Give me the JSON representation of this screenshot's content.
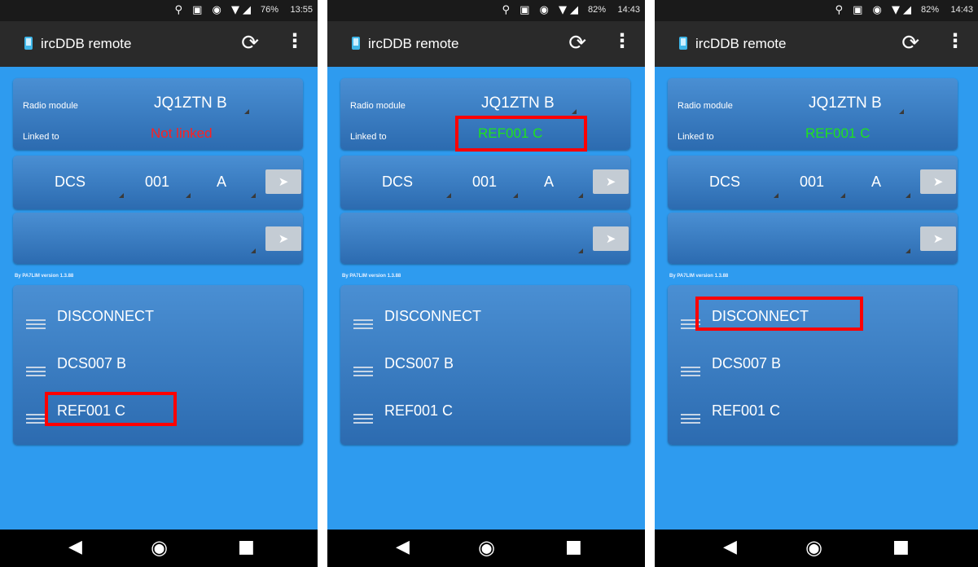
{
  "colors": {
    "background_blue": "#2e9bef",
    "card_blue": "#3a7cc2",
    "not_linked_red": "#ff2020",
    "linked_green": "#1ee21e",
    "highlight_red": "#ff0000"
  },
  "icons": {
    "app": "phone-icon",
    "refresh": "refresh-icon",
    "menu": "overflow-menu-icon",
    "send": "send-arrow-icon",
    "back": "back-icon",
    "home": "home-icon",
    "recent": "recent-apps-icon"
  },
  "app": {
    "title": "ircDDB remote"
  },
  "labels": {
    "radio_module": "Radio module",
    "linked_to": "Linked to",
    "version": "By PA7LIM version 1.3.88"
  },
  "screens": [
    {
      "status": {
        "battery": "76%",
        "time": "13:55"
      },
      "radio_module": "JQ1ZTN B",
      "linked_to": "Not linked",
      "linked_state": "not-linked",
      "spinners": [
        "DCS",
        "001",
        "A"
      ],
      "list": [
        "DISCONNECT",
        "DCS007 B",
        "REF001 C"
      ],
      "highlight": "list item REF001 C"
    },
    {
      "status": {
        "battery": "82%",
        "time": "14:43"
      },
      "radio_module": "JQ1ZTN B",
      "linked_to": "REF001 C",
      "linked_state": "linked",
      "spinners": [
        "DCS",
        "001",
        "A"
      ],
      "list": [
        "DISCONNECT",
        "DCS007 B",
        "REF001 C"
      ],
      "highlight": "linked value"
    },
    {
      "status": {
        "battery": "82%",
        "time": "14:43"
      },
      "radio_module": "JQ1ZTN B",
      "linked_to": "REF001 C",
      "linked_state": "linked",
      "spinners": [
        "DCS",
        "001",
        "A"
      ],
      "list": [
        "DISCONNECT",
        "DCS007 B",
        "REF001 C"
      ],
      "highlight": "list item DISCONNECT"
    }
  ]
}
